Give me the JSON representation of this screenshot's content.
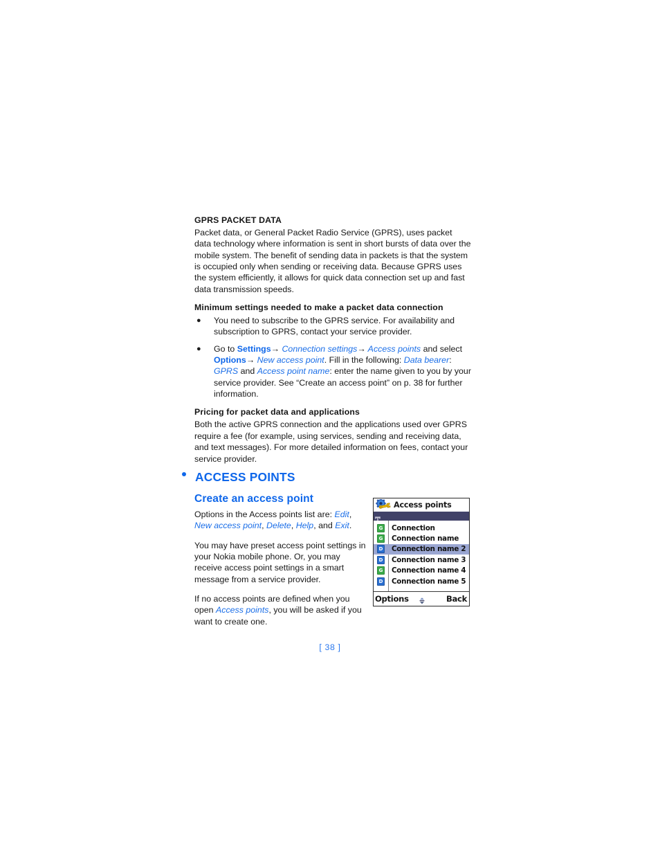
{
  "document": {
    "page_number": "[ 38 ]",
    "accent_blue": "#0f67ea",
    "link_blue": "#1a6ee8"
  },
  "sections": {
    "gprs": {
      "heading": "GPRS PACKET DATA",
      "paragraph": "Packet data, or General Packet Radio Service (GPRS), uses packet data technology where information is sent in short bursts of data over the mobile system. The benefit of sending data in packets is that the system is occupied only when sending or receiving data. Because GPRS uses the system efficiently, it allows for quick data connection set up and fast data transmission speeds."
    },
    "minimum_settings": {
      "heading": "Minimum settings needed to make a packet data connection",
      "bullet_1": "You need to subscribe to the GPRS service. For availability and subscription to GPRS, contact your service provider.",
      "bullet_2": {
        "t1": "Go to ",
        "settings": "Settings",
        "arrow1": "→",
        "connection_settings": " Connection settings",
        "arrow2": "→",
        "access_points": " Access points",
        "t2": " and select ",
        "options": "Options",
        "arrow3": "→",
        "new_access_point": " New access point",
        "t3": ". Fill in the following: ",
        "data_bearer": "Data bearer",
        "t4": ": ",
        "gprs": "GPRS",
        "t5": " and ",
        "access_point_name": "Access point name",
        "t6": ": enter the name given to you by your service provider. See “Create an access point” on p. 38 for further information."
      }
    },
    "pricing": {
      "heading": "Pricing for packet data and applications",
      "paragraph": "Both the active GPRS connection and the applications used over GPRS require a fee (for example, using services, sending and receiving data, and text messages). For more detailed information on fees, contact your service provider."
    },
    "access_points": {
      "heading": "ACCESS POINTS",
      "subheading": "Create an access point",
      "options_line": {
        "lead": "Options in the Access points list are: ",
        "edit": "Edit",
        "sep1": ", ",
        "new_access_point": "New access point",
        "sep2": ", ",
        "delete": "Delete",
        "sep3": ", ",
        "help": "Help",
        "sep4": ", and ",
        "exit": "Exit",
        "end": "."
      },
      "paragraph_1": "You may have preset access point settings in your Nokia mobile phone. Or, you may receive access point settings in a smart message from a service provider.",
      "paragraph_2": {
        "t1": "If no access points are defined when you open ",
        "link": "Access points",
        "t2": ", you will be asked if you want to create one."
      }
    }
  },
  "phone_mock": {
    "title": "Access points",
    "title_icon": "gear-wrench-icon",
    "status_icon": "signal-antenna-icon",
    "list": [
      {
        "label": "Connection",
        "bearer": "G",
        "selected": false
      },
      {
        "label": "Connection name",
        "bearer": "G",
        "selected": false
      },
      {
        "label": "Connection name 2",
        "bearer": "D",
        "selected": true
      },
      {
        "label": "Connection name 3",
        "bearer": "D",
        "selected": false
      },
      {
        "label": "Connection name 4",
        "bearer": "G",
        "selected": false
      },
      {
        "label": "Connection name 5",
        "bearer": "D",
        "selected": false
      }
    ],
    "softkeys": {
      "left": "Options",
      "middle_icon": "scroll-updown-icon",
      "right": "Back"
    },
    "colors": {
      "statusbar": "#414268",
      "selection": "#9aa6d2",
      "gprs_badge": "#3bab4a",
      "data_badge": "#2a6fd1"
    }
  }
}
